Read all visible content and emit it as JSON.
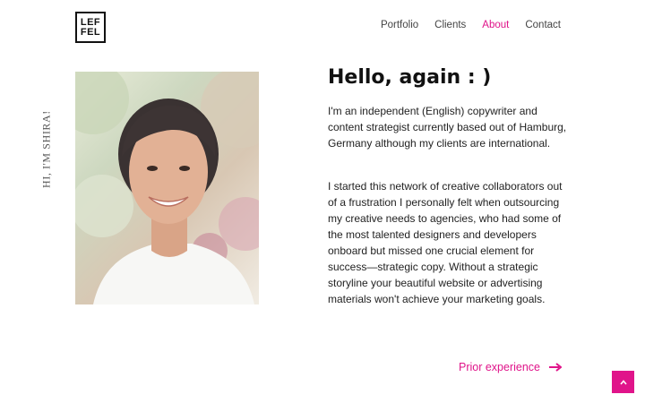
{
  "header": {
    "logo": {
      "line1": "LEF",
      "line2": "FEL"
    },
    "nav": [
      {
        "label": "Portfolio",
        "active": false
      },
      {
        "label": "Clients",
        "active": false
      },
      {
        "label": "About",
        "active": true
      },
      {
        "label": "Contact",
        "active": false
      }
    ]
  },
  "side_text": "HI, I'M SHIRA!",
  "portrait": {
    "alt_icon": "portrait-photo"
  },
  "content": {
    "heading": "Hello, again : )",
    "paragraphs": [
      "I'm an independent (English) copywriter and content strategist currently based out of Hamburg, Germany although my clients are international.",
      "I started this network of creative collaborators out of a frustration I personally felt when outsourcing my creative needs to agencies, who had some of the most talented designers and developers onboard but missed one crucial element for success—strategic copy. Without a strategic storyline your beautiful website or advertising materials won't achieve your marketing goals."
    ],
    "prior_link": "Prior experience"
  },
  "icons": {
    "prior_arrow": "arrow-right-icon",
    "back_to_top": "chevron-up-icon"
  },
  "colors": {
    "accent": "#e0148a",
    "text": "#222222",
    "nav_text": "#444444"
  }
}
